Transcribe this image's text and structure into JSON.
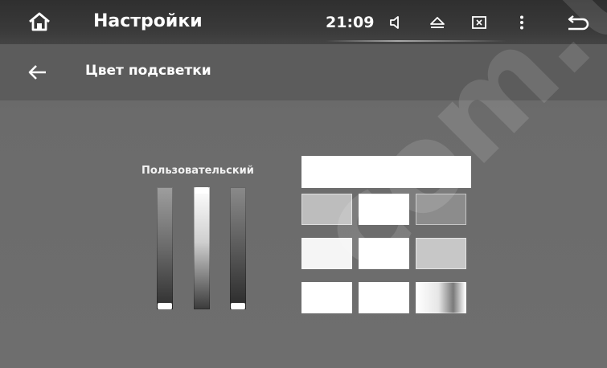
{
  "status_bar": {
    "title": "Настройки",
    "time": "21:09",
    "icons": [
      "home-icon",
      "volume-icon",
      "eject-icon",
      "close-box-icon",
      "more-vert-icon",
      "return-icon"
    ]
  },
  "subheader": {
    "back_icon": "arrow-left-icon",
    "title": "Цвет подсветки"
  },
  "custom": {
    "label": "Пользовательский",
    "sliders": [
      {
        "name": "left",
        "level": 0.0
      },
      {
        "name": "middle",
        "level": 1.0
      },
      {
        "name": "right",
        "level": 0.0
      }
    ]
  },
  "watermark": "com.ua",
  "colors": {
    "preview": "#ffffff",
    "swatches": [
      "#bdbdbd",
      "#ffffff",
      "#8c8c8c",
      "#f5f5f5",
      "#ffffff",
      "#c7c7c7",
      "#ffffff",
      "#ffffff",
      "#d9d9d9"
    ]
  }
}
